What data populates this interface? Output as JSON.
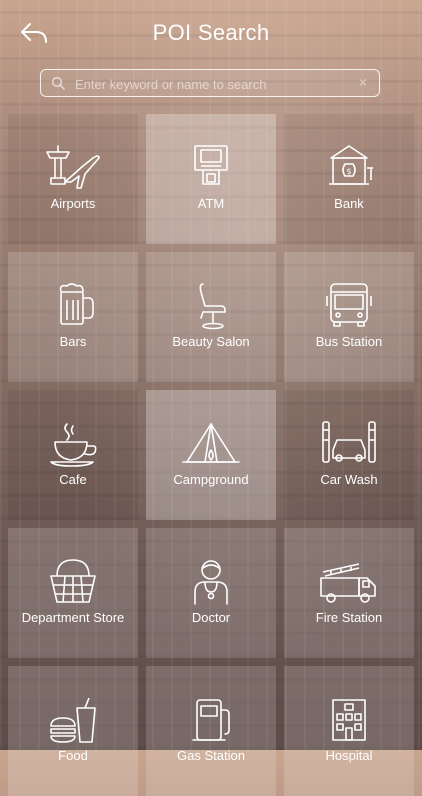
{
  "header": {
    "title": "POI Search"
  },
  "search": {
    "placeholder": "Enter keyword or name to search",
    "clear": "×"
  },
  "categories": [
    {
      "label": "Airports",
      "icon": "airport-icon"
    },
    {
      "label": "ATM",
      "icon": "atm-icon"
    },
    {
      "label": "Bank",
      "icon": "bank-icon"
    },
    {
      "label": "Bars",
      "icon": "beer-mug-icon"
    },
    {
      "label": "Beauty Salon",
      "icon": "salon-chair-icon"
    },
    {
      "label": "Bus Station",
      "icon": "bus-icon"
    },
    {
      "label": "Cafe",
      "icon": "coffee-cup-icon"
    },
    {
      "label": "Campground",
      "icon": "tent-icon"
    },
    {
      "label": "Car Wash",
      "icon": "car-wash-icon"
    },
    {
      "label": "Department Store",
      "icon": "basket-icon"
    },
    {
      "label": "Doctor",
      "icon": "doctor-icon"
    },
    {
      "label": "Fire Station",
      "icon": "fire-truck-icon"
    },
    {
      "label": "Food",
      "icon": "food-icon"
    },
    {
      "label": "Gas Station",
      "icon": "gas-pump-icon"
    },
    {
      "label": "Hospital",
      "icon": "hospital-icon"
    }
  ]
}
